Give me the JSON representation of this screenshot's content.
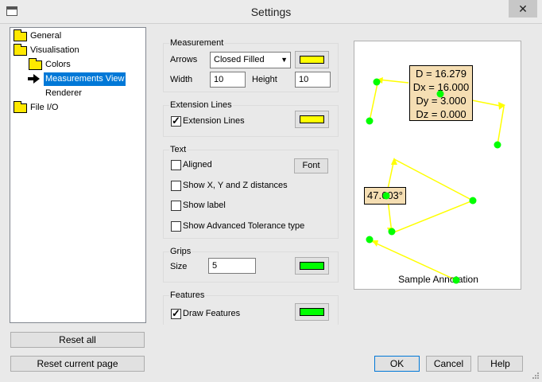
{
  "window": {
    "title": "Settings",
    "close_glyph": "✕"
  },
  "tree": {
    "items": [
      {
        "label": "General",
        "icon": "folder-icon"
      },
      {
        "label": "Visualisation",
        "icon": "folder-open-icon"
      },
      {
        "label": "Colors",
        "icon": "folder-icon"
      },
      {
        "label": "Measurements View",
        "icon": "arrow-icon",
        "selected": true
      },
      {
        "label": "Renderer",
        "icon": "none"
      },
      {
        "label": "File I/O",
        "icon": "folder-icon"
      }
    ]
  },
  "left_buttons": {
    "reset_all": "Reset all",
    "reset_page": "Reset current page"
  },
  "measurement": {
    "title": "Measurement",
    "arrows_label": "Arrows",
    "arrows_value": "Closed Filled",
    "arrow_color": "#ffff00",
    "width_label": "Width",
    "width_value": "10",
    "height_label": "Height",
    "height_value": "10"
  },
  "extension": {
    "title": "Extension Lines",
    "checkbox_label": "Extension Lines",
    "checked": true,
    "color": "#ffff00"
  },
  "text": {
    "title": "Text",
    "aligned": "Aligned",
    "font_button": "Font",
    "show_xyz": "Show X, Y and Z distances",
    "show_label": "Show label",
    "show_tolerance": "Show Advanced Tolerance type"
  },
  "grips": {
    "title": "Grips",
    "size_label": "Size",
    "size_value": "5",
    "color": "#00ff00"
  },
  "features": {
    "title": "Features",
    "checkbox_label": "Draw Features",
    "checked": true,
    "color": "#00ff00"
  },
  "preview": {
    "measure_lines": [
      "D = 16.279",
      "Dx = 16.000",
      "Dy = 3.000",
      "Dz = 0.000"
    ],
    "angle_label": "47.603°",
    "caption": "Sample Annotation"
  },
  "dialog_buttons": {
    "ok": "OK",
    "cancel": "Cancel",
    "help": "Help"
  }
}
